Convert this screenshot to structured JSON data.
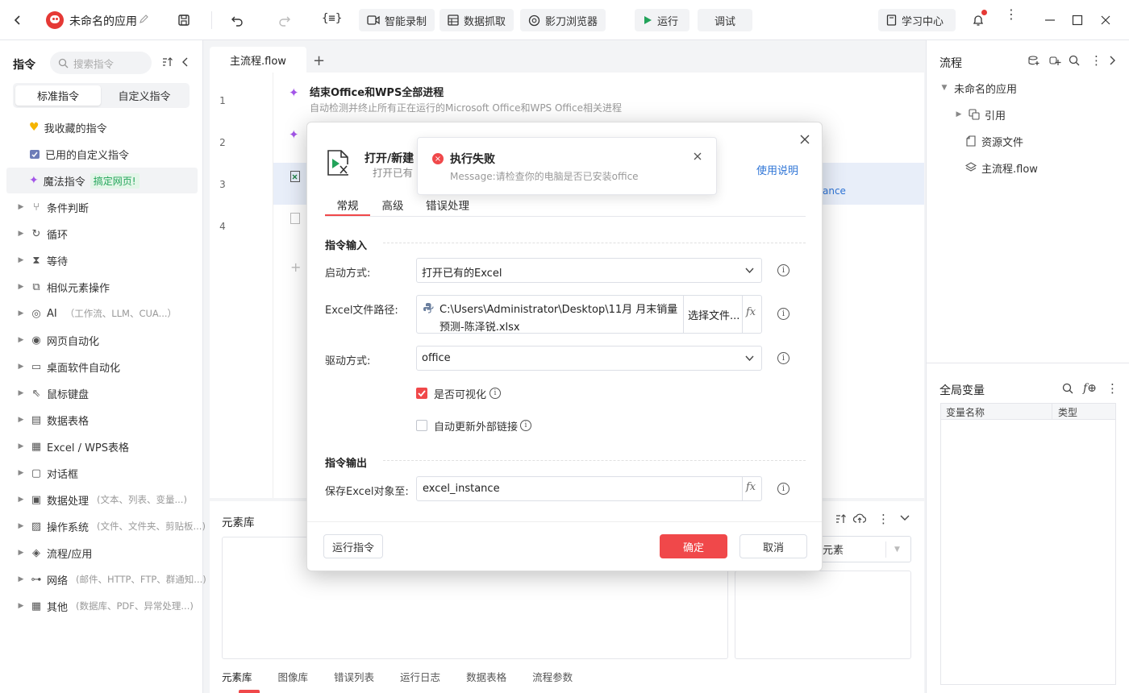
{
  "topbar": {
    "app_title": "未命名的应用",
    "smart_record": "智能录制",
    "data_capture": "数据抓取",
    "browser": "影刀浏览器",
    "run": "运行",
    "debug": "调试",
    "learning_center": "学习中心"
  },
  "sidebar": {
    "title": "指令",
    "search_placeholder": "搜索指令",
    "tab_standard": "标准指令",
    "tab_custom": "自定义指令",
    "favorites": "我收藏的指令",
    "used_custom": "已用的自定义指令",
    "magic": "魔法指令",
    "magic_badge": "搞定网页!",
    "categories": [
      {
        "label": "条件判断",
        "sub": ""
      },
      {
        "label": "循环",
        "sub": ""
      },
      {
        "label": "等待",
        "sub": ""
      },
      {
        "label": "相似元素操作",
        "sub": ""
      },
      {
        "label": "AI",
        "sub": "（工作流、LLM、CUA...）"
      },
      {
        "label": "网页自动化",
        "sub": ""
      },
      {
        "label": "桌面软件自动化",
        "sub": ""
      },
      {
        "label": "鼠标键盘",
        "sub": ""
      },
      {
        "label": "数据表格",
        "sub": ""
      },
      {
        "label": "Excel / WPS表格",
        "sub": ""
      },
      {
        "label": "对话框",
        "sub": ""
      },
      {
        "label": "数据处理",
        "sub": "(文本、列表、变量...)"
      },
      {
        "label": "操作系统",
        "sub": "(文件、文件夹、剪贴板...)"
      },
      {
        "label": "流程/应用",
        "sub": ""
      },
      {
        "label": "网络",
        "sub": "(邮件、HTTP、FTP、群通知...)"
      },
      {
        "label": "其他",
        "sub": "(数据库、PDF、异常处理...)"
      }
    ]
  },
  "editor": {
    "tab": "主流程.flow",
    "rows": [
      "1",
      "2",
      "3",
      "4"
    ],
    "step1_title": "结束Office和WPS全部进程",
    "step1_desc": "自动检测并终止所有正在运行的Microsoft Office和WPS Office相关进程",
    "step3_tail": "ance"
  },
  "bottom": {
    "title": "元素库",
    "element_select": "元素",
    "tabs": [
      "元素库",
      "图像库",
      "错误列表",
      "运行日志",
      "数据表格",
      "流程参数"
    ]
  },
  "right": {
    "flow_title": "流程",
    "tree_root": "未命名的应用",
    "tree_items": [
      "引用",
      "资源文件",
      "主流程.flow"
    ],
    "vars_title": "全局变量",
    "col_name": "变量名称",
    "col_type": "类型"
  },
  "dialog": {
    "title": "打开/新建",
    "subtitle": "打开已有",
    "help_link": "使用说明",
    "tabs": [
      "常规",
      "高级",
      "错误处理"
    ],
    "input_section": "指令输入",
    "launch_label": "启动方式:",
    "launch_value": "打开已有的Excel",
    "path_label": "Excel文件路径:",
    "path_line1": "C:\\Users\\Administrator\\Desktop\\11月 月末销量",
    "path_line2": "预测-陈泽锐.xlsx",
    "choose_file": "选择文件...",
    "driver_label": "驱动方式:",
    "driver_value": "office",
    "visible_label": "是否可视化",
    "auto_update_label": "自动更新外部链接",
    "output_section": "指令输出",
    "save_label": "保存Excel对象至:",
    "save_value": "excel_instance",
    "run_button": "运行指令",
    "ok_button": "确定",
    "cancel_button": "取消",
    "fx": "fx"
  },
  "toast": {
    "title": "执行失败",
    "message": "Message:请检查你的电脑是否已安装office"
  },
  "colors": {
    "accent_red": "#f0484a",
    "link_blue": "#2e74d6",
    "magic_green": "#23a55a"
  }
}
